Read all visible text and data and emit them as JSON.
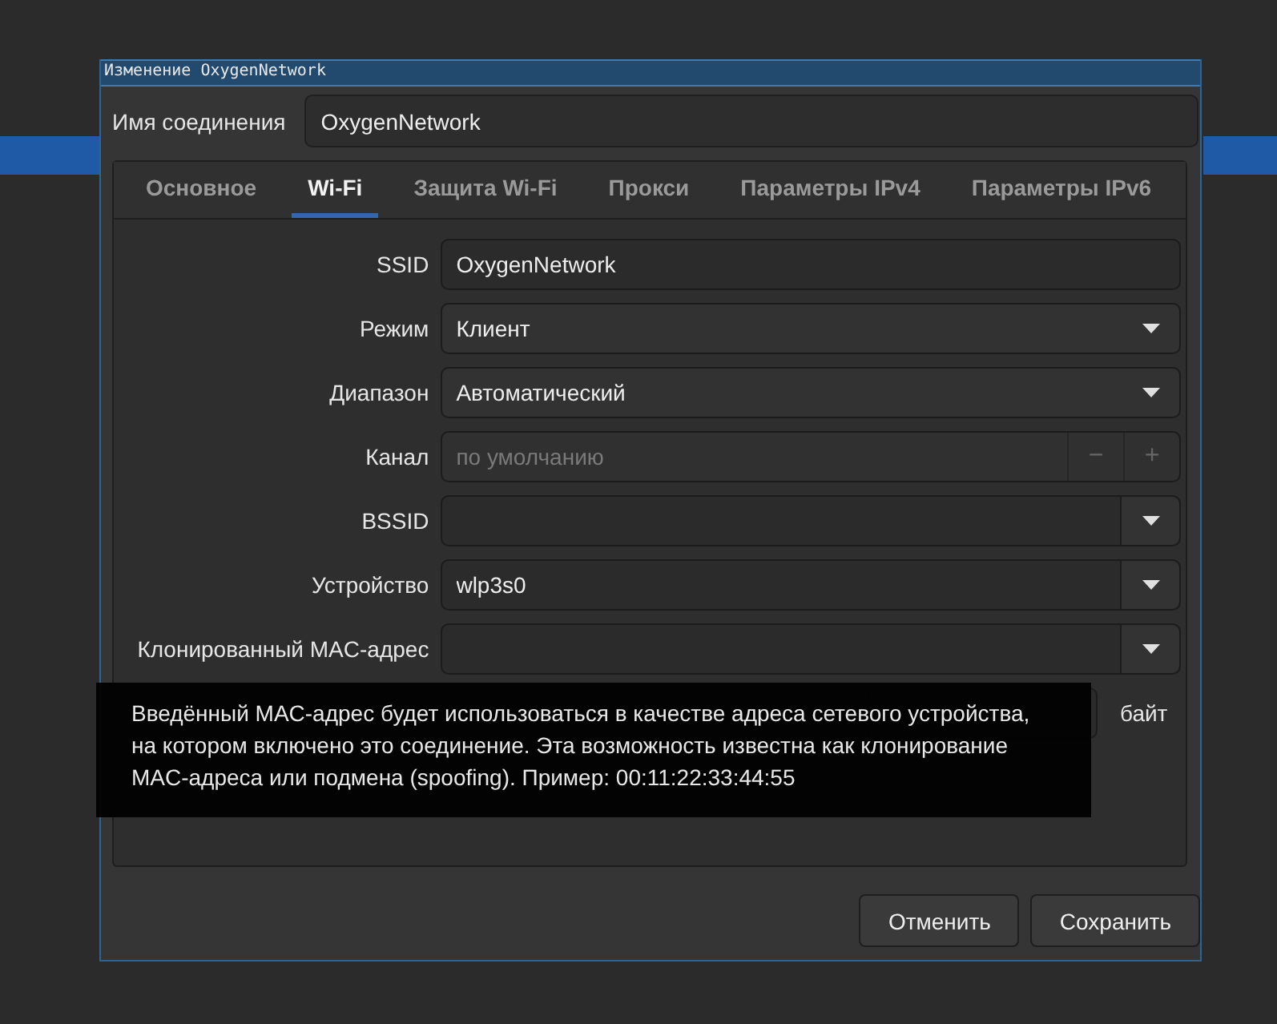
{
  "window": {
    "title": "Изменение OxygenNetwork"
  },
  "connection_name": {
    "label": "Имя соединения",
    "value": "OxygenNetwork"
  },
  "tabs": [
    {
      "label": "Основное",
      "selected": false
    },
    {
      "label": "Wi-Fi",
      "selected": true
    },
    {
      "label": "Защита Wi-Fi",
      "selected": false
    },
    {
      "label": "Прокси",
      "selected": false
    },
    {
      "label": "Параметры IPv4",
      "selected": false
    },
    {
      "label": "Параметры IPv6",
      "selected": false
    }
  ],
  "fields": [
    {
      "kind": "text",
      "label": "SSID",
      "value": "OxygenNetwork"
    },
    {
      "kind": "dropdown",
      "label": "Режим",
      "value": "Клиент"
    },
    {
      "kind": "dropdown",
      "label": "Диапазон",
      "value": "Автоматический"
    },
    {
      "kind": "spin",
      "label": "Канал",
      "placeholder": "по умолчанию",
      "disabled": true,
      "minus": "−",
      "plus": "+"
    },
    {
      "kind": "combo",
      "label": "BSSID"
    },
    {
      "kind": "combo",
      "label": "Устройство",
      "value": "wlp3s0"
    },
    {
      "kind": "combo",
      "label": "Клонированный MAC-адрес"
    }
  ],
  "mtu": {
    "unit": "байт"
  },
  "tooltip": {
    "text": "Введённый MAC-адрес будет использоваться в качестве адреса сетевого устройства, на котором включено это соединение. Эта возможность известна как клонирование MAC-адреса или подмена (spoofing). Пример: 00:11:22:33:44:55"
  },
  "buttons": [
    {
      "label": "Отменить"
    },
    {
      "label": "Сохранить"
    }
  ]
}
